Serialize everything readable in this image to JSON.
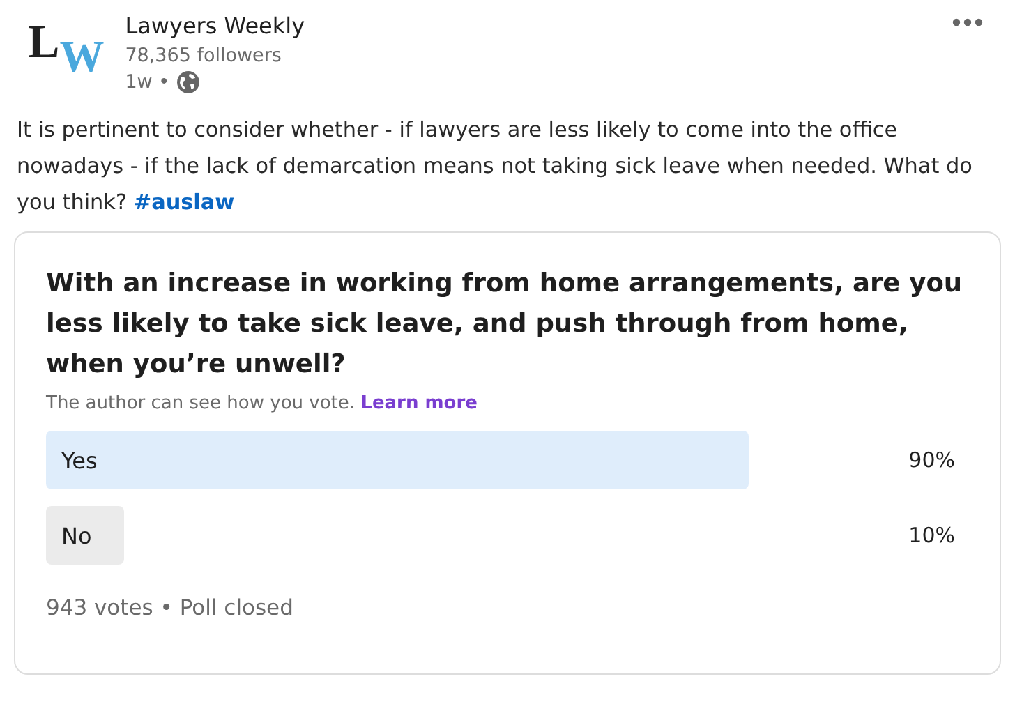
{
  "author": {
    "logo": [
      "L",
      "W"
    ],
    "name": "Lawyers Weekly",
    "followers": "78,365 followers",
    "age": "1w •"
  },
  "post": {
    "text": "It is pertinent to consider whether - if lawyers are less likely to come into the office nowadays - if the lack of demarcation means not taking sick leave when needed. What do you think?",
    "hashtag": "#auslaw"
  },
  "poll": {
    "question": "With an increase in working from home arrangements, are you less likely to take sick leave, and push through from home, when you’re unwell?",
    "notice": "The author can see how you vote.",
    "learn_more": "Learn more",
    "options": [
      {
        "label": "Yes",
        "level": 0.9,
        "percent": "90%",
        "selected": true
      },
      {
        "label": "No",
        "level": 0.1,
        "percent": "10%",
        "selected": false
      }
    ],
    "footer": "943 votes • Poll closed"
  }
}
